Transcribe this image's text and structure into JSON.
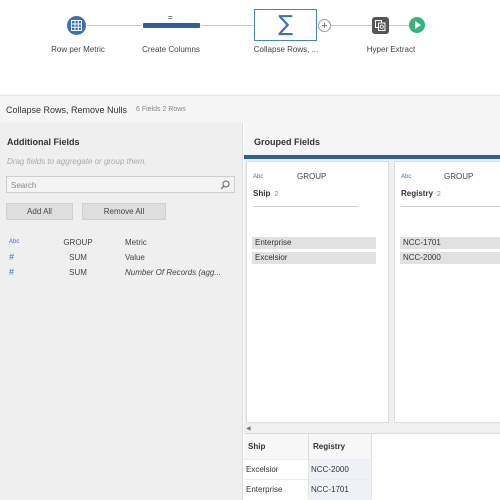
{
  "flow": {
    "steps": [
      {
        "label": "Row per Metric",
        "icon": "table-icon"
      },
      {
        "label": "Create Columns",
        "icon": "pivot-bar-icon",
        "glyph": "="
      },
      {
        "label": "Collapse Rows, ...",
        "icon": "sigma-icon",
        "glyph": "∑"
      },
      {
        "label": "Hyper Extract",
        "icon": "output-icon"
      }
    ],
    "add_icon": "plus-circle-icon",
    "run_icon": "play-icon"
  },
  "step": {
    "title": "Collapse Rows, Remove Nulls",
    "meta": "6 Fields  2 Rows"
  },
  "additional_fields": {
    "title": "Additional Fields",
    "hint": "Drag fields to aggregate or group them.",
    "search_placeholder": "Search",
    "add_all_label": "Add All",
    "remove_all_label": "Remove All",
    "rows": [
      {
        "type": "Abc",
        "agg": "GROUP",
        "name": "Metric"
      },
      {
        "type": "#",
        "agg": "SUM",
        "name": "Value"
      },
      {
        "type": "#",
        "agg": "SUM",
        "name": "Number Of Records (agg..."
      }
    ]
  },
  "grouped_fields": {
    "title": "Grouped Fields",
    "cards": [
      {
        "type": "Abc",
        "agg": "GROUP",
        "name": "Ship",
        "count": "2",
        "values": [
          "Enterprise",
          "Excelsior"
        ]
      },
      {
        "type": "Abc",
        "agg": "GROUP",
        "name": "Registry",
        "count": "2",
        "values": [
          "NCC-1701",
          "NCC-2000"
        ]
      }
    ]
  },
  "preview": {
    "columns": [
      "Ship",
      "Registry"
    ],
    "rows": [
      [
        "Excelsior",
        "NCC-2000"
      ],
      [
        "Enterprise",
        "NCC-1701"
      ]
    ]
  },
  "colors": {
    "accent": "#3d6fb3",
    "dark_accent": "#2f5f95",
    "run_green": "#35b27f"
  }
}
